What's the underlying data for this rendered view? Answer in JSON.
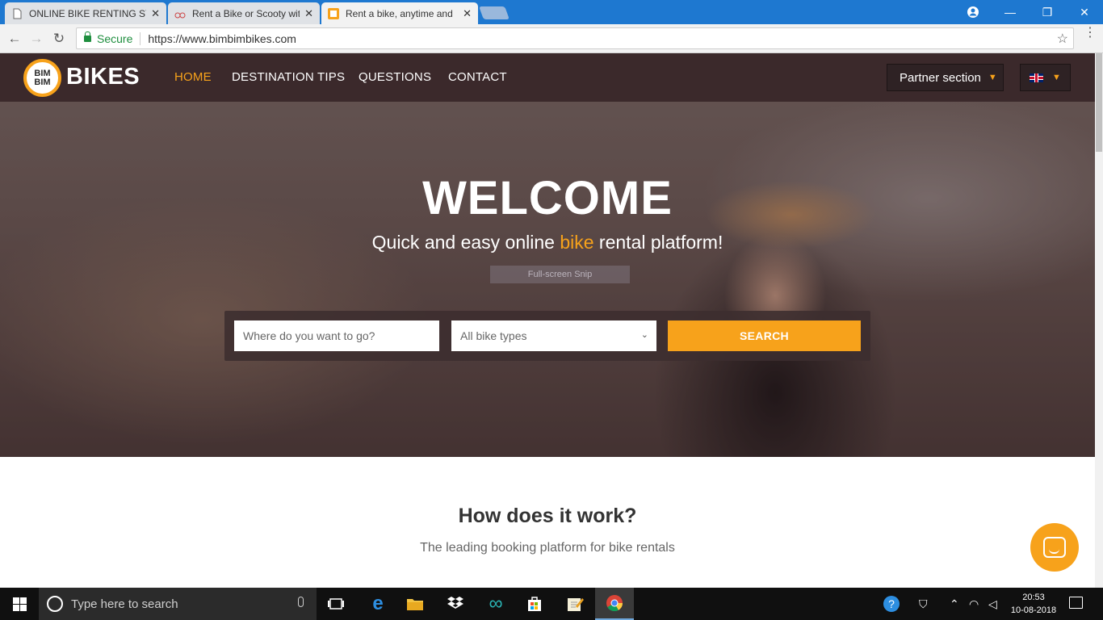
{
  "browser": {
    "tabs": [
      {
        "title": "ONLINE BIKE RENTING SY",
        "active": false
      },
      {
        "title": "Rent a Bike or Scooty with",
        "active": false
      },
      {
        "title": "Rent a bike, anytime and",
        "active": true
      }
    ],
    "close_glyph": "✕",
    "secure_label": "Secure",
    "url": "https://www.bimbimbikes.com",
    "window_controls": {
      "minimize": "—",
      "maximize": "❐",
      "close": "✕"
    }
  },
  "site": {
    "logo": {
      "badge_top": "BIM",
      "badge_bottom": "BIM",
      "wordmark": "BIKES"
    },
    "nav": {
      "items": [
        "HOME",
        "DESTINATION TIPS",
        "QUESTIONS",
        "CONTACT"
      ],
      "active_index": 0
    },
    "partner_label": "Partner section",
    "language": "en-GB"
  },
  "hero": {
    "welcome": "WELCOME",
    "tagline_before": "Quick and easy online ",
    "tagline_highlight": "bike",
    "tagline_after": " rental platform!",
    "snip_overlay": "Full-screen Snip"
  },
  "search": {
    "where_placeholder": "Where do you want to go?",
    "bike_type_selected": "All bike types",
    "button_label": "SEARCH"
  },
  "how": {
    "title": "How does it work?",
    "subtitle": "The leading booking platform for bike rentals"
  },
  "taskbar": {
    "search_placeholder": "Type here to search",
    "time": "20:53",
    "date": "10-08-2018"
  },
  "colors": {
    "accent": "#f7a21b",
    "nav_bg": "#372628",
    "taskbar": "#101010",
    "browser_frame": "#1e78d0"
  }
}
